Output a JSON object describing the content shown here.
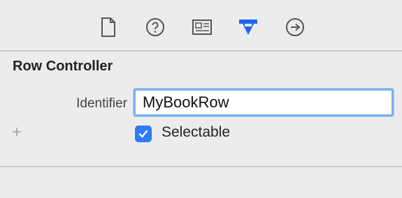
{
  "toolbar": {
    "icons": [
      {
        "name": "file-inspector-icon"
      },
      {
        "name": "quick-help-icon"
      },
      {
        "name": "identity-inspector-icon"
      },
      {
        "name": "attributes-inspector-icon",
        "active": true,
        "color": "#1a66f0"
      },
      {
        "name": "connections-inspector-icon"
      }
    ]
  },
  "section": {
    "title": "Row Controller"
  },
  "identifier": {
    "label": "Identifier",
    "value": "MyBookRow"
  },
  "add": {
    "symbol": "+"
  },
  "selectable": {
    "label": "Selectable",
    "checked": true,
    "color": "#2d7cf6"
  }
}
